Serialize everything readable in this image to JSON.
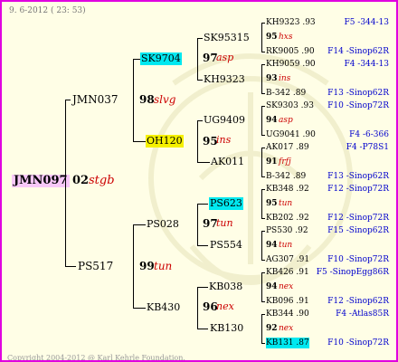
{
  "header": {
    "date": "9. 6-2012 ( 23: 53)"
  },
  "footer": {
    "copyright": "Copyright 2004-2012 @ Karl Kehrle Foundation."
  },
  "subject": {
    "name": "JMN097",
    "code": "02",
    "mark": "stgb"
  },
  "gen1": [
    {
      "name": "JMN037",
      "code": "98",
      "mark": "slvg"
    },
    {
      "name": "PS517",
      "code": "99",
      "mark": "tun"
    }
  ],
  "gen2": [
    {
      "name": "SK9704",
      "code": "97",
      "mark": "asp"
    },
    {
      "name": "OH120",
      "code": "95",
      "mark": "ins"
    },
    {
      "name": "PS028",
      "code": "97",
      "mark": "tun"
    },
    {
      "name": "KB430",
      "code": "96",
      "mark": "nex"
    }
  ],
  "gen3": [
    {
      "name": "SK95315"
    },
    {
      "name": "KH9323"
    },
    {
      "name": "UG9409"
    },
    {
      "name": "AK011"
    },
    {
      "name": "PS623"
    },
    {
      "name": "PS554"
    },
    {
      "name": "KB038"
    },
    {
      "name": "KB130"
    }
  ],
  "gen4": [
    {
      "top": "KH9323 .93",
      "top_right": "F5 -344-13",
      "code": "95",
      "mark": "hxs",
      "bottom": "RK9005 .90",
      "bottom_right": "F14 -Sinop62R"
    },
    {
      "top": "KH9059 .90",
      "top_right": "F4 -344-13",
      "code": "93",
      "mark": "ins",
      "bottom": "B-342 .89",
      "bottom_right": "F13 -Sinop62R"
    },
    {
      "top": "SK9303 .93",
      "top_right": "F10 -Sinop72R",
      "code": "94",
      "mark": "asp",
      "bottom": "UG9041 .90",
      "bottom_right": "F4 -6-366"
    },
    {
      "top": "AK017 .89",
      "top_right": "F4 -P78S1",
      "code": "91",
      "mark": "frfj",
      "bottom": "B-342 .89",
      "bottom_right": "F13 -Sinop62R"
    },
    {
      "top": "KB348 .92",
      "top_right": "F12 -Sinop72R",
      "code": "95",
      "mark": "tun",
      "bottom": "KB202 .92",
      "bottom_right": "F12 -Sinop72R"
    },
    {
      "top": "PS530 .92",
      "top_right": "F15 -Sinop62R",
      "code": "94",
      "mark": "tun",
      "bottom": "AG307 .91",
      "bottom_right": "F10 -Sinop72R"
    },
    {
      "top": "KB426 .91",
      "top_right": "F5 -SinopEgg86R",
      "code": "94",
      "mark": "nex",
      "bottom": "KB096 .91",
      "bottom_right": "F12 -Sinop62R"
    },
    {
      "top": "KB344 .90",
      "top_right": "F4 -Atlas85R",
      "code": "92",
      "mark": "nex",
      "bottom": "KB131 .87",
      "bottom_right": "F10 -Sinop72R"
    }
  ],
  "colors": {
    "border": "#e000e0",
    "background": "#fffee6",
    "highlight_cyan": "#00e8f0",
    "highlight_yellow": "#f5f000",
    "highlight_pink": "#f8c8f8",
    "link_blue": "#0000cc",
    "mark_red": "#cc0000"
  }
}
